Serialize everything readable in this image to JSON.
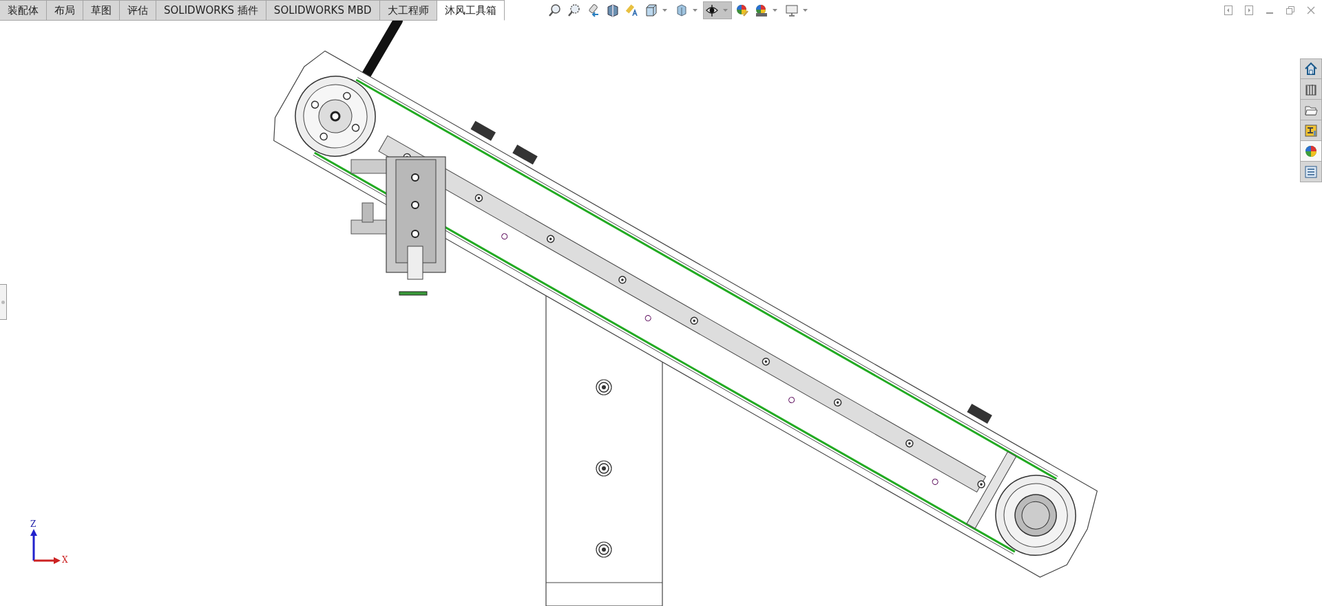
{
  "tabs": [
    {
      "label": "装配体",
      "selected": false
    },
    {
      "label": "布局",
      "selected": false
    },
    {
      "label": "草图",
      "selected": false
    },
    {
      "label": "评估",
      "selected": false
    },
    {
      "label": "SOLIDWORKS 插件",
      "selected": false
    },
    {
      "label": "SOLIDWORKS MBD",
      "selected": false
    },
    {
      "label": "大工程师",
      "selected": false
    },
    {
      "label": "沐风工具箱",
      "selected": true
    }
  ],
  "view_toolbar": [
    {
      "kind": "zoom-fit",
      "selected": false,
      "dropdown": false
    },
    {
      "kind": "zoom-area",
      "selected": false,
      "dropdown": false
    },
    {
      "kind": "previous-view",
      "selected": false,
      "dropdown": false
    },
    {
      "kind": "section",
      "selected": false,
      "dropdown": false
    },
    {
      "kind": "annotation",
      "selected": false,
      "dropdown": false
    },
    {
      "kind": "orientation",
      "selected": false,
      "dropdown": true
    },
    {
      "kind": "display-style",
      "selected": false,
      "dropdown": true
    },
    {
      "kind": "hide-show",
      "selected": true,
      "dropdown": true
    },
    {
      "kind": "appearance",
      "selected": false,
      "dropdown": false
    },
    {
      "kind": "scene",
      "selected": false,
      "dropdown": true
    },
    {
      "kind": "monitor",
      "selected": false,
      "dropdown": true
    }
  ],
  "task_pane": [
    {
      "kind": "home",
      "selected": false
    },
    {
      "kind": "library",
      "selected": false
    },
    {
      "kind": "folder",
      "selected": false
    },
    {
      "kind": "palette",
      "selected": false
    },
    {
      "kind": "appearance",
      "selected": true
    },
    {
      "kind": "properties",
      "selected": false
    }
  ],
  "triad": {
    "z_label": "Z",
    "x_label": "X"
  }
}
